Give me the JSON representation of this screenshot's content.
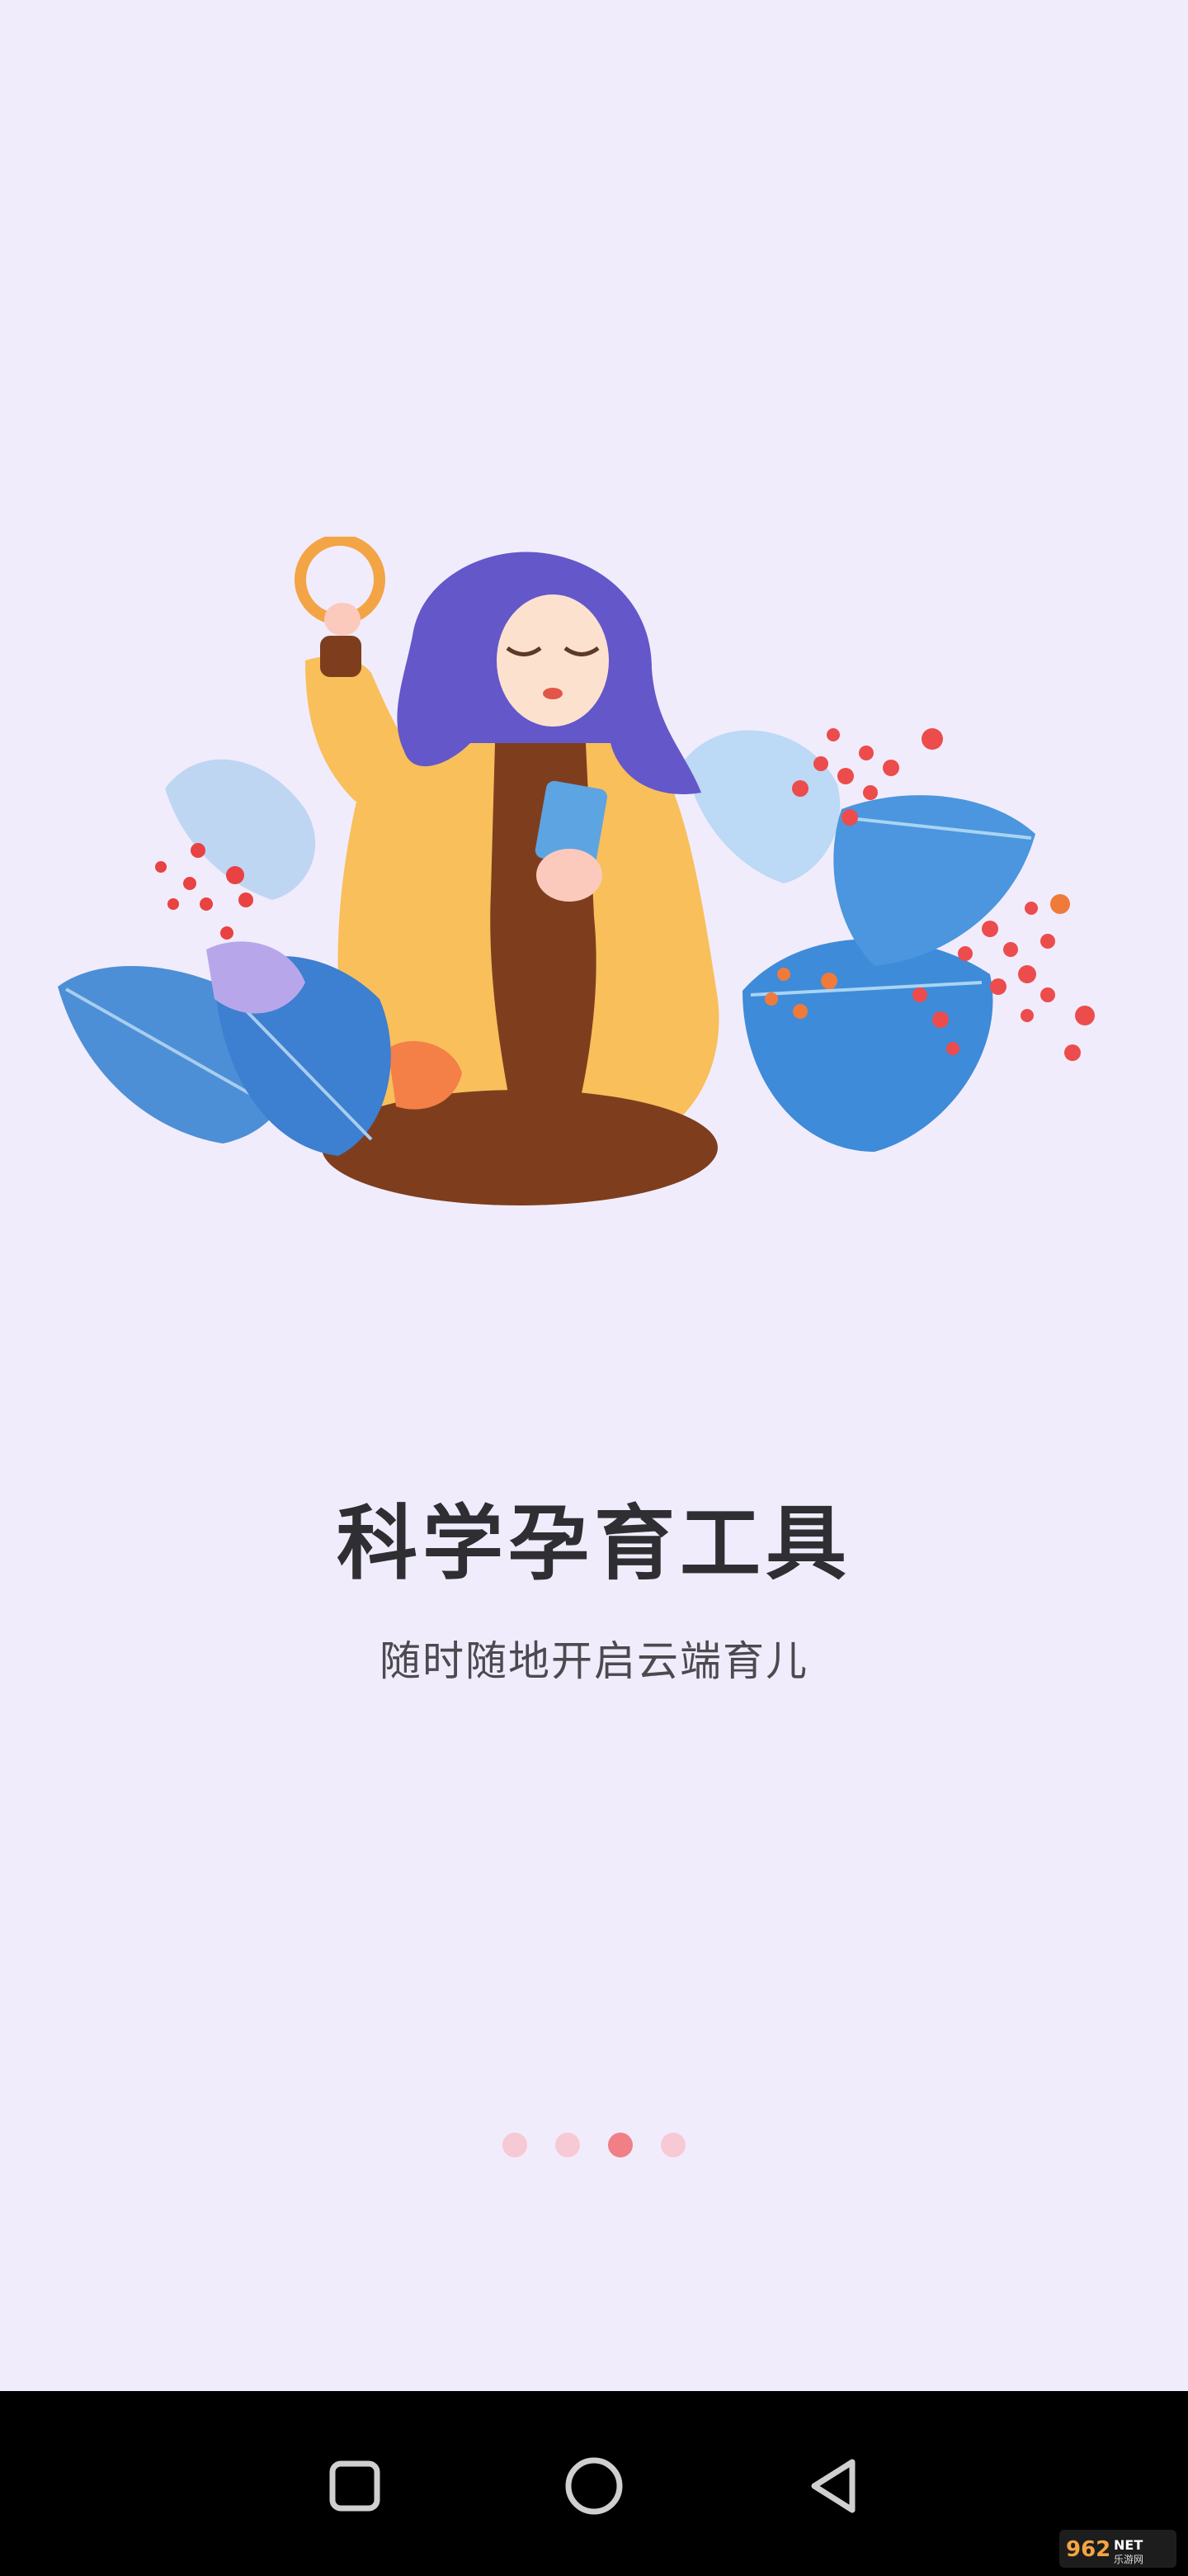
{
  "onboarding": {
    "title": "科学孕育工具",
    "subtitle": "随时随地开启云端育儿",
    "illustration_icon": "woman-reading-phone-among-leaves-illustration",
    "pagination": {
      "total": 4,
      "active_index": 3,
      "active_color": "#f07f86",
      "inactive_color": "#f7c9d4"
    }
  },
  "navigation_bar": {
    "recent_icon": "square-recents-icon",
    "home_icon": "circle-home-icon",
    "back_icon": "triangle-back-icon"
  },
  "watermark": {
    "text": "962NET 乐游网"
  },
  "colors": {
    "background": "#f1ecfc",
    "title": "#2f2f33",
    "subtitle": "#4a4a4f",
    "navbar": "#000000"
  }
}
